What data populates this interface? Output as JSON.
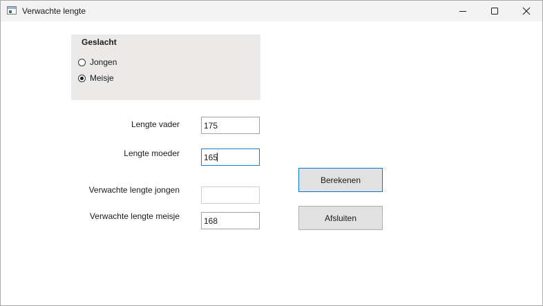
{
  "window": {
    "title": "Verwachte lengte",
    "icon": "form-app-icon",
    "controls": [
      "minimize-icon",
      "maximize-icon",
      "close-icon"
    ]
  },
  "gender_group": {
    "title": "Geslacht",
    "options": [
      {
        "label": "Jongen",
        "selected": false
      },
      {
        "label": "Meisje",
        "selected": true
      }
    ]
  },
  "fields": {
    "father": {
      "label": "Lengte vader",
      "value": "175"
    },
    "mother": {
      "label": "Lengte moeder",
      "value": "165"
    },
    "expected_boy": {
      "label": "Verwachte lengte jongen",
      "value": ""
    },
    "expected_girl": {
      "label": "Verwachte lengte meisje",
      "value": "168"
    }
  },
  "buttons": {
    "calculate": "Berekenen",
    "close": "Afsluiten"
  },
  "colors": {
    "titlebar": "#f3f3f3",
    "groupbox": "#ece9e9",
    "focus_border": "#1e78c8",
    "button_face": "#e1e1e1",
    "default_button_border": "#0078d4"
  }
}
